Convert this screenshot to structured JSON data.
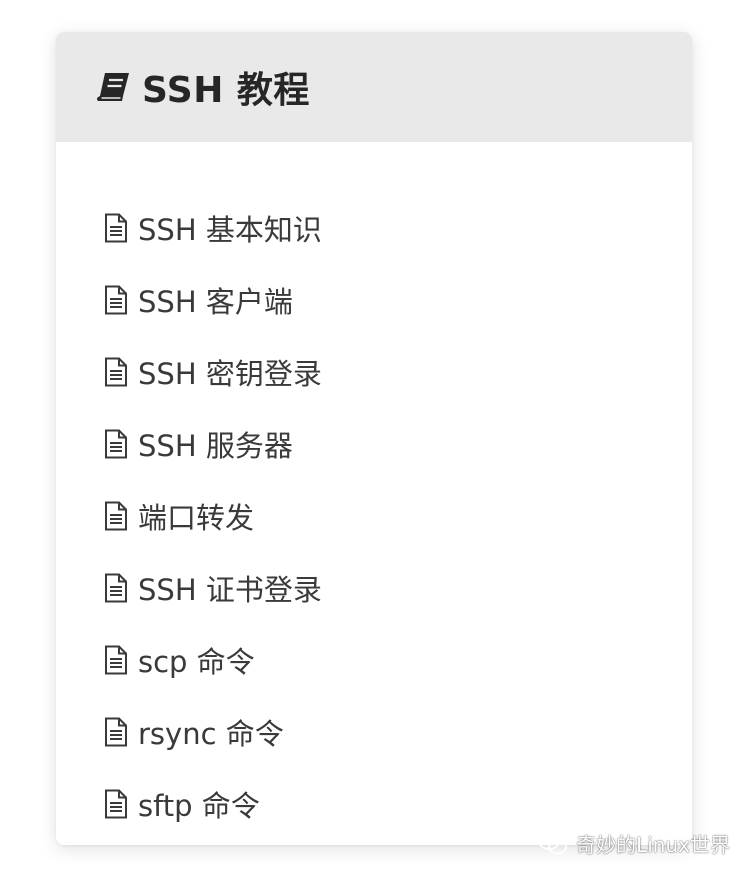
{
  "colors": {
    "header_bg": "#e9e9e9",
    "card_bg": "#ffffff",
    "title_text": "#262626",
    "item_text": "#3a3a3a"
  },
  "header": {
    "icon": "book-icon",
    "title": "SSH 教程"
  },
  "menu": {
    "items": [
      {
        "icon": "document-icon",
        "label": "SSH 基本知识"
      },
      {
        "icon": "document-icon",
        "label": "SSH 客户端"
      },
      {
        "icon": "document-icon",
        "label": "SSH 密钥登录"
      },
      {
        "icon": "document-icon",
        "label": "SSH 服务器"
      },
      {
        "icon": "document-icon",
        "label": "端口转发"
      },
      {
        "icon": "document-icon",
        "label": "SSH 证书登录"
      },
      {
        "icon": "document-icon",
        "label": "scp 命令"
      },
      {
        "icon": "document-icon",
        "label": "rsync 命令"
      },
      {
        "icon": "document-icon",
        "label": "sftp 命令"
      }
    ]
  },
  "watermark": {
    "icon": "wechat-icon",
    "text": "奇妙的Linux世界"
  }
}
